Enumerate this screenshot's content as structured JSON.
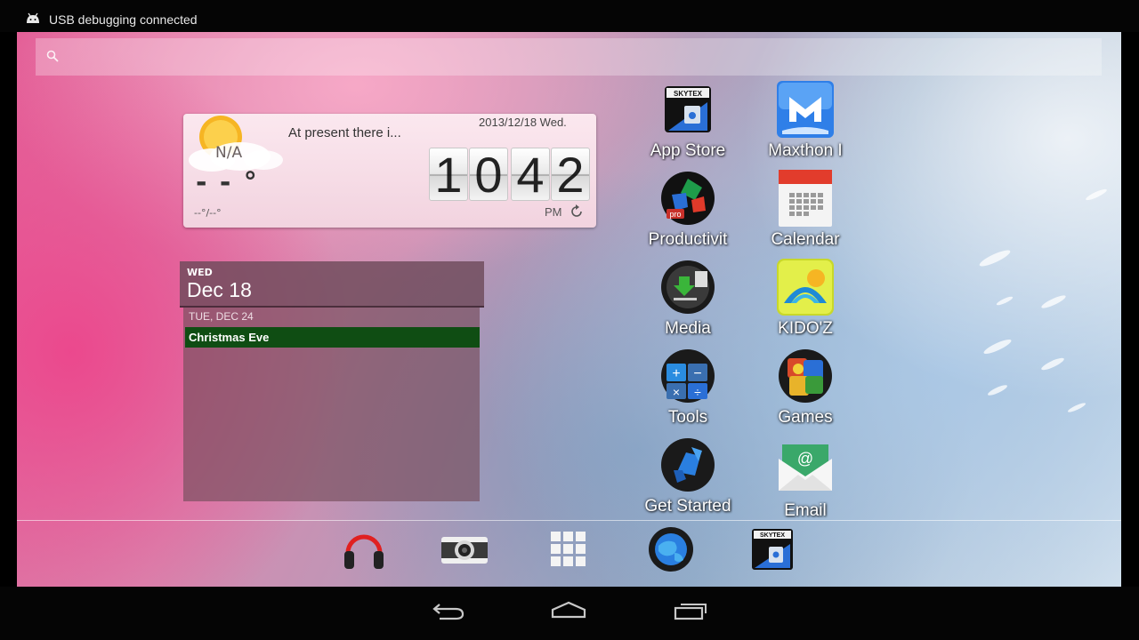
{
  "status_bar": {
    "notification": "USB debugging connected"
  },
  "search": {
    "placeholder": ""
  },
  "weather": {
    "condition": "N/A",
    "temperature": "- - °",
    "range": "--°/--°",
    "description": "At present there i...",
    "date": "2013/12/18  Wed.",
    "clock_digits": [
      "1",
      "0",
      "4",
      "2"
    ],
    "ampm": "PM"
  },
  "calendar": {
    "day_of_week": "WED",
    "date": "Dec 18",
    "event_day": "TUE, DEC 24",
    "event_title": "Christmas Eve"
  },
  "apps": [
    {
      "label": "App Store",
      "icon": "app-store-icon"
    },
    {
      "label": "Maxthon I",
      "icon": "maxthon-icon"
    },
    {
      "label": "Productivit",
      "icon": "productivity-icon"
    },
    {
      "label": "Calendar",
      "icon": "calendar-icon"
    },
    {
      "label": "Media",
      "icon": "media-icon"
    },
    {
      "label": "KIDO'Z",
      "icon": "kidoz-icon"
    },
    {
      "label": "Tools",
      "icon": "tools-icon"
    },
    {
      "label": "Games",
      "icon": "games-icon"
    },
    {
      "label": "Get Started",
      "icon": "get-started-icon"
    },
    {
      "label": "Email",
      "icon": "email-icon"
    }
  ],
  "dock": [
    "headphones-icon",
    "camera-icon",
    "app-drawer-icon",
    "browser-globe-icon",
    "app-store-icon"
  ],
  "nav": [
    "back-icon",
    "home-icon",
    "recent-apps-icon"
  ],
  "colors": {
    "event_bar": "#0f4d13",
    "status_bar": "#050505",
    "nav_bar": "#050505"
  }
}
